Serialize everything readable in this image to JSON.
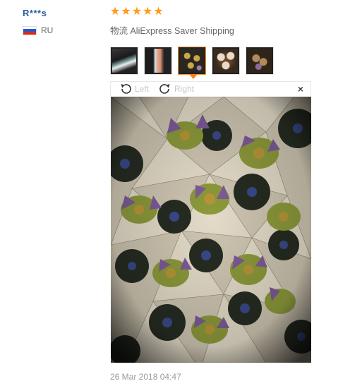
{
  "reviewer": {
    "name": "R***s",
    "country": "RU"
  },
  "rating": {
    "stars": 5,
    "max": 5
  },
  "shipping": {
    "text": "物流 AliExpress Saver Shipping"
  },
  "gallery": {
    "thumbnails": [
      {
        "name": "thumbnail-1",
        "active": false
      },
      {
        "name": "thumbnail-2",
        "active": false
      },
      {
        "name": "thumbnail-3",
        "active": true
      },
      {
        "name": "thumbnail-4",
        "active": false
      },
      {
        "name": "thumbnail-5",
        "active": false
      }
    ],
    "toolbar": {
      "rotate_left": "Left",
      "rotate_right": "Right",
      "close": "×"
    }
  },
  "review": {
    "date": "26 Mar 2018 04:47"
  },
  "colors": {
    "star": "#ff9a1a",
    "name": "#2a5d9f",
    "active_border": "#ff9a1a"
  },
  "icons": [
    "star-icon",
    "flag-icon",
    "rotate-left-icon",
    "rotate-right-icon",
    "close-icon"
  ]
}
